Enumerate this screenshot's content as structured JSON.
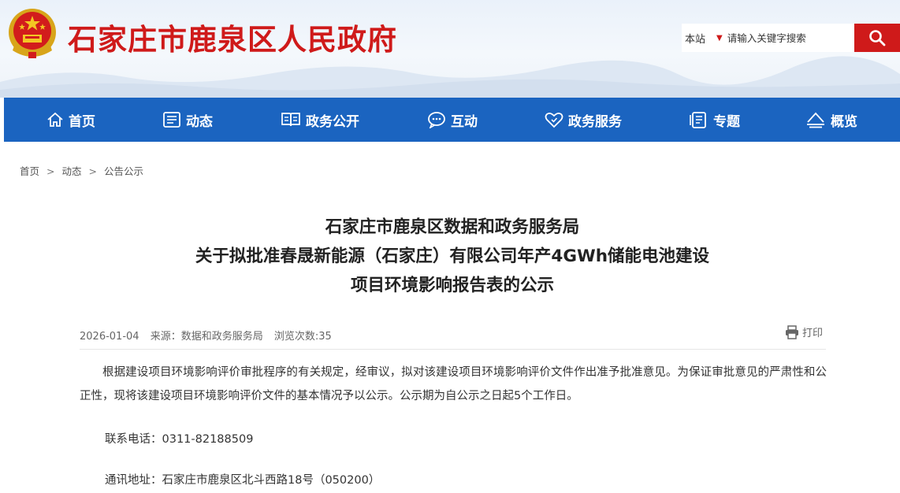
{
  "header": {
    "site_title": "石家庄市鹿泉区人民政府",
    "search_scope": "本站",
    "search_placeholder": "请输入关键字搜索"
  },
  "nav": {
    "items": [
      {
        "label": "首页",
        "icon": "home-icon"
      },
      {
        "label": "动态",
        "icon": "news-icon"
      },
      {
        "label": "政务公开",
        "icon": "book-icon"
      },
      {
        "label": "互动",
        "icon": "chat-icon"
      },
      {
        "label": "政务服务",
        "icon": "heart-icon"
      },
      {
        "label": "专题",
        "icon": "topic-icon"
      },
      {
        "label": "概览",
        "icon": "overview-icon"
      }
    ]
  },
  "breadcrumb": [
    "首页",
    "动态",
    "公告公示"
  ],
  "article": {
    "title_lines": [
      "石家庄市鹿泉区数据和政务服务局",
      "关于拟批准春晟新能源（石家庄）有限公司年产4GWh储能电池建设",
      "项目环境影响报告表的公示"
    ],
    "date": "2026-01-04",
    "source": "来源：数据和政务服务局",
    "views": "浏览次数:35",
    "print_label": "打印",
    "paragraph": "根据建设项目环境影响评价审批程序的有关规定，经审议，拟对该建设项目环境影响评价文件作出准予批准意见。为保证审批意见的严肃性和公正性，现将该建设项目环境影响评价文件的基本情况予以公示。公示期为自公示之日起5个工作日。",
    "phone": "联系电话：0311-82188509",
    "address": "通讯地址：石家庄市鹿泉区北斗西路18号（050200）"
  },
  "colors": {
    "brand_red": "#cf1a1a",
    "nav_blue": "#1b64c0"
  }
}
